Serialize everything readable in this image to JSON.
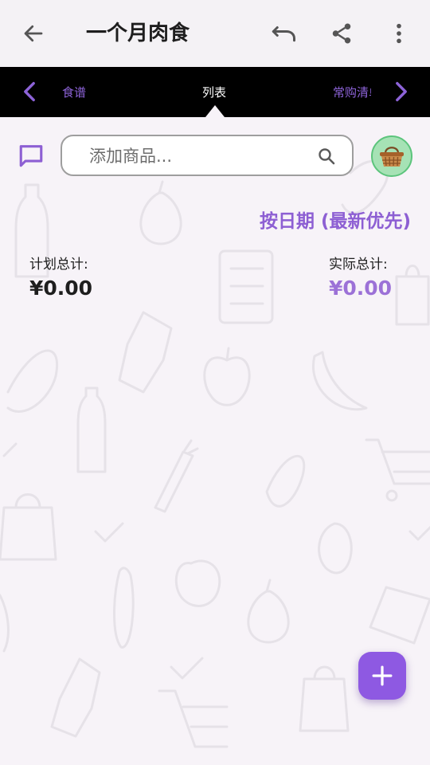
{
  "app": {
    "title": "一个月肉食"
  },
  "tabs": {
    "prev": "食谱",
    "active": "列表",
    "next": "常购清单"
  },
  "search": {
    "placeholder": "添加商品...",
    "value": ""
  },
  "sort": {
    "label": "按日期 (最新优先)"
  },
  "totals": {
    "planned_label": "计划总计:",
    "planned_value": "¥0.00",
    "actual_label": "实际总计:",
    "actual_value": "¥0.00"
  },
  "icons": {
    "back": "arrow-left-icon",
    "undo": "undo-icon",
    "share": "share-icon",
    "more": "more-vertical-icon",
    "tab_prev": "chevron-left-icon",
    "tab_next": "chevron-right-icon",
    "chat": "chat-icon",
    "search": "search-icon",
    "basket": "basket-icon",
    "fab": "plus-icon"
  },
  "colors": {
    "accent": "#8e59e2",
    "sort_text": "#8d5fd3",
    "actual_total": "#9c71d7",
    "tab_bar": "#000000",
    "basket_bg": "#a6e2b5"
  }
}
